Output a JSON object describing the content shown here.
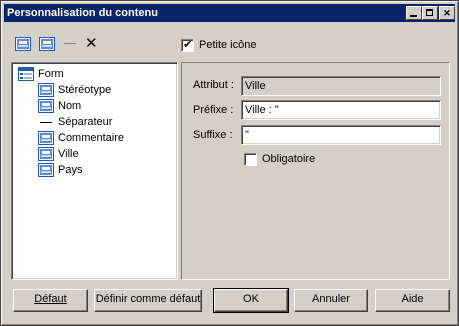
{
  "window": {
    "title": "Personnalisation du contenu"
  },
  "titlebar_buttons": {
    "minimize": "minimize-icon",
    "maximize": "maximize-icon",
    "close": "close-icon",
    "close_glyph": "✕"
  },
  "toolbar": {
    "icons": [
      "add-item-icon",
      "insert-item-icon",
      "separator-icon",
      "delete-icon"
    ],
    "delete_glyph": "✕"
  },
  "small_icon": {
    "label": "Petite icône",
    "checked": true,
    "check_glyph": "✔"
  },
  "tree": {
    "root": {
      "label": "Form",
      "icon": "form-icon"
    },
    "items": [
      {
        "label": "Stéréotype",
        "icon": "attribute-icon"
      },
      {
        "label": "Nom",
        "icon": "attribute-icon"
      },
      {
        "label": "Séparateur",
        "icon": "separator-line-icon"
      },
      {
        "label": "Commentaire",
        "icon": "attribute-icon"
      },
      {
        "label": "Ville",
        "icon": "attribute-icon"
      },
      {
        "label": "Pays",
        "icon": "attribute-icon"
      }
    ]
  },
  "properties": {
    "attribute": {
      "label": "Attribut :",
      "value": "Ville"
    },
    "prefix": {
      "label": "Préfixe :",
      "value": "Ville : \""
    },
    "suffix": {
      "label": "Suffixe :",
      "value": "\""
    },
    "mandatory": {
      "label": "Obligatoire",
      "checked": false
    }
  },
  "buttons": {
    "default_label": "Défaut",
    "set_default_label": "Définir comme défaut",
    "ok_label": "OK",
    "cancel_label": "Annuler",
    "help_label": "Aide"
  },
  "colors": {
    "titlebar": "#0a246a",
    "face": "#d4d0c8",
    "icon_blue": "#1e5ab4"
  }
}
